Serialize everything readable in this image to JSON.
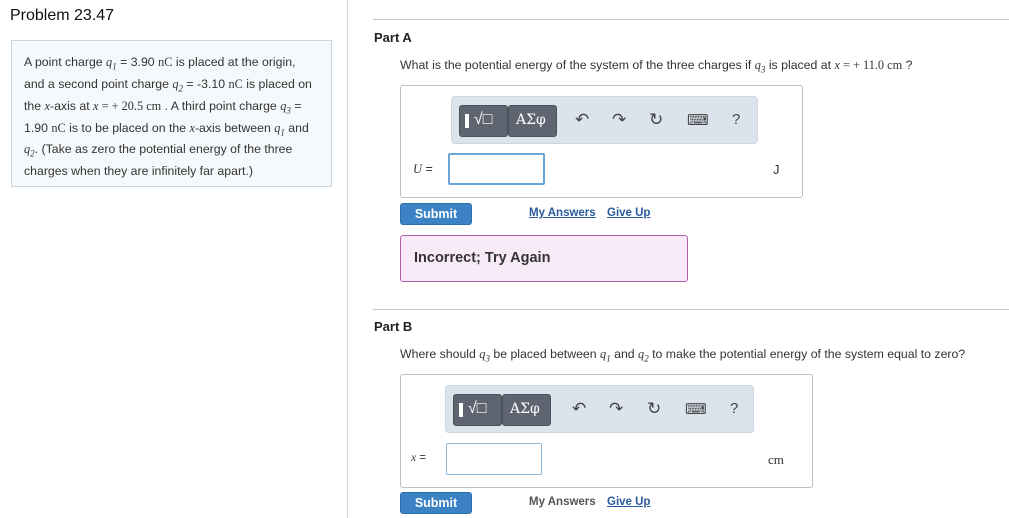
{
  "problem": {
    "title": "Problem 23.47",
    "statement": {
      "t1": "A point charge ",
      "q1": "q",
      "q1_sub": "1",
      "t2": " = 3.90 ",
      "unit_nC_1": "nC",
      "t3": " is placed at the origin, and a second point charge ",
      "q2": "q",
      "q2_sub": "2",
      "t4": " = -3.10 ",
      "unit_nC_2": "nC",
      "t5": " is placed on the ",
      "x1": "x",
      "t6": "-axis at ",
      "x2": "x",
      "t7": " = + 20.5 cm",
      "t8": " . A third point charge ",
      "q3": "q",
      "q3_sub": "3",
      "t9": " = 1.90 ",
      "unit_nC_3": "nC",
      "t10": " is to be placed on the ",
      "x3": "x",
      "t11": "-axis between ",
      "q1b": "q",
      "q1b_sub": "1",
      "t12": " and ",
      "q2b": "q",
      "q2b_sub": "2",
      "t13": ". (Take as zero the potential energy of the three charges when they are infinitely far apart.)"
    }
  },
  "partA": {
    "title": "Part A",
    "question": {
      "t1": "What is the potential energy of the system of the three charges if ",
      "q3": "q",
      "q3_sub": "3",
      "t2": " is placed at ",
      "x": "x",
      "t3": " = + 11.0 cm",
      "t4": " ?"
    },
    "toolbar": {
      "templates": "√□",
      "greek": "ΑΣφ",
      "undo": "↶",
      "redo": "↷",
      "reset": "↻",
      "keyboard": "⌨",
      "help": "?"
    },
    "var": "U",
    "eq": " =",
    "input_value": "",
    "unit": "J",
    "submit": "Submit",
    "my_answers": "My Answers",
    "give_up": "Give Up",
    "feedback": "Incorrect; Try Again"
  },
  "partB": {
    "title": "Part B",
    "question": {
      "t1": "Where should ",
      "q3": "q",
      "q3_sub": "3",
      "t2": " be placed between ",
      "q1": "q",
      "q1_sub": "1",
      "t3": " and ",
      "q2": "q",
      "q2_sub": "2",
      "t4": " to make the potential energy of the system equal to zero?"
    },
    "toolbar": {
      "templates": "√□",
      "greek": "ΑΣφ",
      "undo": "↶",
      "redo": "↷",
      "reset": "↻",
      "keyboard": "⌨",
      "help": "?"
    },
    "var": "x",
    "eq": " =",
    "input_value": "",
    "unit": "cm",
    "submit": "Submit",
    "my_answers": "My Answers",
    "give_up": "Give Up"
  }
}
